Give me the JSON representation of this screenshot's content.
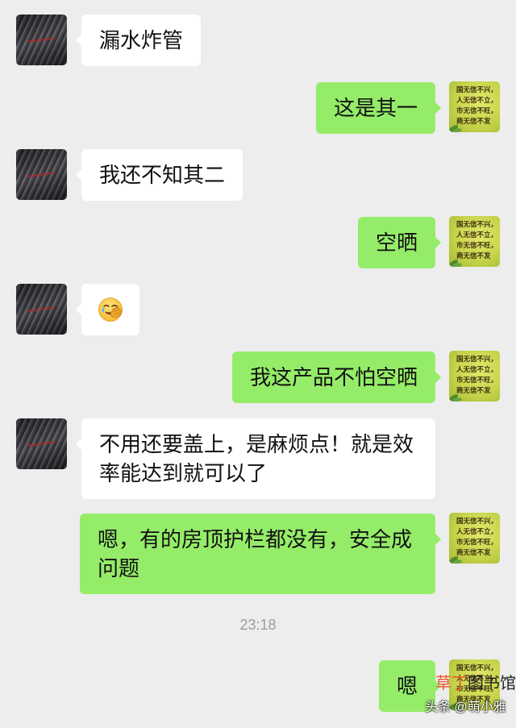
{
  "chat": {
    "other_avatar": "solar-collector-avatar",
    "me_avatar": "motto-avatar",
    "me_avatar_lettering": [
      "国无信不兴，",
      "人无信不立，",
      "市无信不旺，",
      "商无信不发"
    ]
  },
  "messages": [
    {
      "side": "left",
      "text": "漏水炸管"
    },
    {
      "side": "right",
      "text": "这是其一"
    },
    {
      "side": "left",
      "text": "我还不知其二"
    },
    {
      "side": "right",
      "text": "空晒"
    },
    {
      "side": "left",
      "emoji": "facepalm-emoji"
    },
    {
      "side": "right",
      "text": "我这产品不怕空晒"
    },
    {
      "side": "left",
      "text": "不用还要盖上，是麻烦点！就是效率能达到就可以了"
    },
    {
      "side": "right",
      "text": "嗯，有的房顶护栏都没有，安全成问题"
    },
    {
      "side": "right",
      "text": "嗯"
    }
  ],
  "timestamp": "23:18",
  "watermark": {
    "logo_part1": "草丁",
    "logo_part2": "图书馆",
    "source": "头条 @萌小雅"
  },
  "colors": {
    "background": "#ededed",
    "incoming_bubble": "#ffffff",
    "outgoing_bubble": "#95ec69",
    "timestamp_text": "#9b9b9b"
  }
}
